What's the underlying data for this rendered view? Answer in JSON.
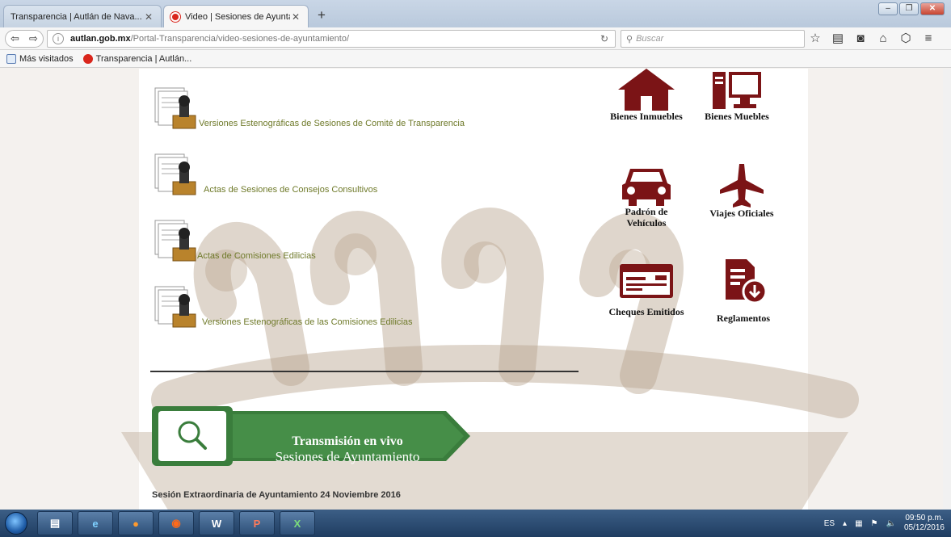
{
  "browser": {
    "tabs": [
      {
        "label": "Transparencia | Autlán de Nava...",
        "active": false
      },
      {
        "label": "Video | Sesiones de Ayunta...",
        "active": true
      }
    ],
    "new_tab": "+",
    "url_domain": "autlan.gob.mx",
    "url_path": "/Portal-Transparencia/video-sesiones-de-ayuntamiento/",
    "search_placeholder": "Buscar",
    "bookmarks": [
      {
        "label": "Más visitados"
      },
      {
        "label": "Transparencia | Autlán..."
      }
    ]
  },
  "documents": [
    {
      "label": "Versiones Estenográficas de Sesiones de Comité de Transparencia"
    },
    {
      "label": "Actas de Sesiones de Consejos Consultivos"
    },
    {
      "label": "Actas de Comisiones Edilicias"
    },
    {
      "label": "Versiones Estenográficas de las Comisiones Edilicias"
    }
  ],
  "live": {
    "title": "Transmisión en vivo",
    "subtitle": "Sesiones de Ayuntamiento"
  },
  "session_note": "Sesión Extraordinaria de Ayuntamiento 24 Noviembre 2016",
  "tiles": [
    {
      "label": "Bienes Inmuebles",
      "icon": "house-icon"
    },
    {
      "label": "Bienes Muebles",
      "icon": "computer-icon"
    },
    {
      "label": "Padrón de Vehículos",
      "icon": "car-icon"
    },
    {
      "label": "Viajes Oficiales",
      "icon": "airplane-icon"
    },
    {
      "label": "Cheques Emitidos",
      "icon": "check-icon"
    },
    {
      "label": "Reglamentos",
      "icon": "document-download-icon"
    }
  ],
  "taskbar": {
    "apps": [
      "folder",
      "ie",
      "firefox",
      "media",
      "W",
      "P",
      "X"
    ],
    "language": "ES",
    "time": "09:50 p.m.",
    "date": "05/12/2016"
  },
  "colors": {
    "accent_maroon": "#7b1416",
    "link_olive": "#6f7a2a",
    "banner_green": "#3a7d3c"
  }
}
